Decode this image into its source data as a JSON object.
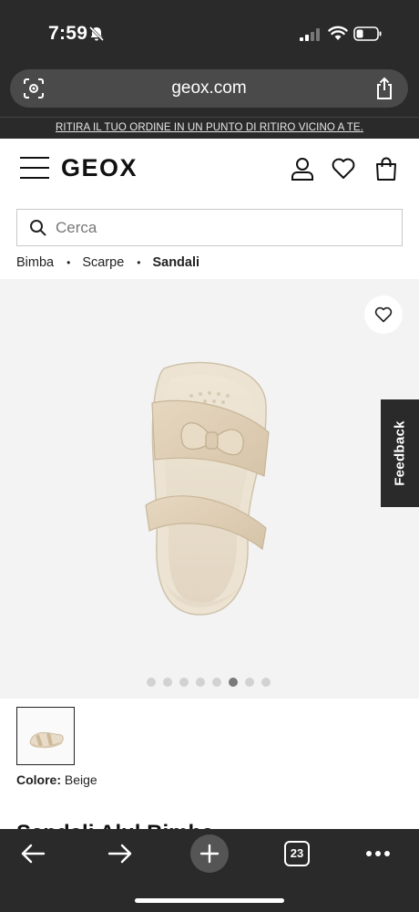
{
  "status_bar": {
    "time": "7:59"
  },
  "browser": {
    "url": "geox.com",
    "tabs_count": "23"
  },
  "promo": {
    "text": "RITIRA IL TUO ORDINE IN UN PUNTO DI RITIRO VICINO A TE."
  },
  "header": {
    "logo": "GEOX"
  },
  "search": {
    "placeholder": "Cerca"
  },
  "breadcrumb": {
    "items": [
      "Bimba",
      "Scarpe",
      "Sandali"
    ],
    "separator": "•"
  },
  "gallery": {
    "image_count": 8,
    "active_index": 5,
    "feedback_label": "Feedback"
  },
  "colour": {
    "label": "Colore:",
    "value": "Beige"
  },
  "product": {
    "title_partial": "Sandali Alul Bimba"
  },
  "colors": {
    "chrome": "#2a2a2a",
    "gallery_bg": "#f3f3f3",
    "dot_active": "#7a7a7a",
    "dot": "#d2d2d2"
  }
}
